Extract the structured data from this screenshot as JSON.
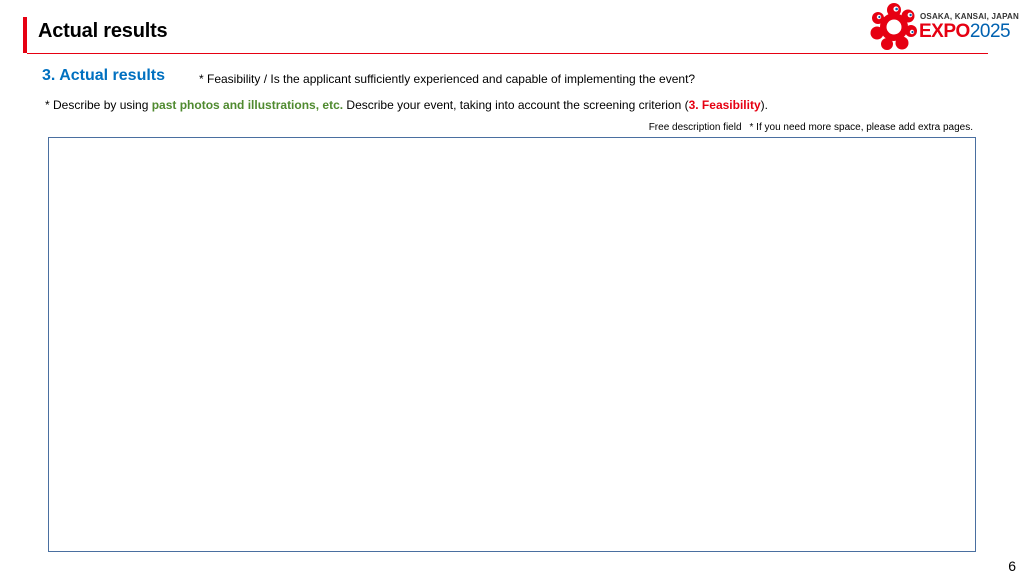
{
  "header": {
    "title": "Actual results"
  },
  "logo": {
    "location": "OSAKA, KANSAI, JAPAN",
    "expo": "EXPO",
    "year": "2025"
  },
  "section": {
    "heading": "3. Actual results",
    "criterion": "* Feasibility / Is the applicant sufficiently experienced and capable of implementing the event?"
  },
  "instruction": {
    "part1": "* Describe by using ",
    "highlight": "past photos and illustrations, etc.",
    "part2": " Describe your event, taking into account the screening criterion (",
    "criterion_ref": "3. Feasibility",
    "part3": ")."
  },
  "field": {
    "label": "Free description field",
    "note": "* If you need more space, please add extra pages.",
    "content": ""
  },
  "page": {
    "number": "6"
  },
  "colors": {
    "accent_red": "#e60012",
    "heading_blue": "#0070c0",
    "highlight_green": "#4f8a2f",
    "box_border": "#4a6fa0"
  }
}
